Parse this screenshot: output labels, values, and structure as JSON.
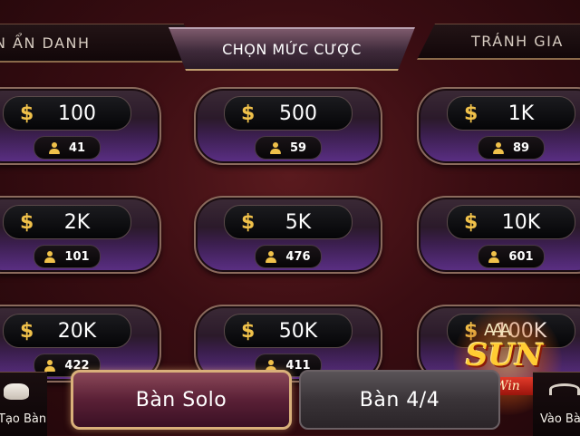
{
  "tabs": {
    "left": "N ẨN DANH",
    "center": "CHỌN MỨC CƯỢC",
    "right": "TRÁNH GIA"
  },
  "currency_symbol": "$",
  "rooms": [
    {
      "bet": "100",
      "players": "41"
    },
    {
      "bet": "500",
      "players": "59"
    },
    {
      "bet": "1K",
      "players": "89"
    },
    {
      "bet": "2K",
      "players": "101"
    },
    {
      "bet": "5K",
      "players": "476"
    },
    {
      "bet": "10K",
      "players": "601"
    },
    {
      "bet": "20K",
      "players": "422"
    },
    {
      "bet": "50K",
      "players": "411"
    },
    {
      "bet": "100K",
      "players": ""
    }
  ],
  "bottom": {
    "create_table": "Tạo Bàn",
    "solo": "Bàn Solo",
    "four": "Bàn 4/4",
    "join_table": "Vào Bà"
  },
  "logo": {
    "brand": "SUN",
    "sub": "Win",
    "cards": "AAA"
  },
  "colors": {
    "gold": "#f0c14a",
    "background": "#3a0d12",
    "active_button_border": "#d9b07a"
  }
}
